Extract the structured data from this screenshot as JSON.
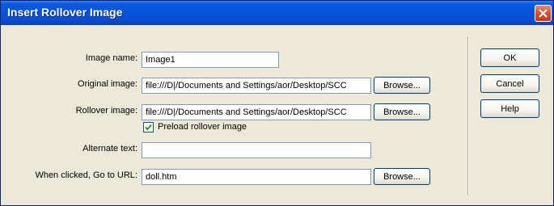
{
  "window": {
    "title": "Insert Rollover Image"
  },
  "form": {
    "image_name_label": "Image name:",
    "image_name_value": "Image1",
    "original_image_label": "Original image:",
    "original_image_value": "file:///D|/Documents and Settings/aor/Desktop/SCC",
    "rollover_image_label": "Rollover image:",
    "rollover_image_value": "file:///D|/Documents and Settings/aor/Desktop/SCC",
    "preload_label": "Preload rollover image",
    "preload_checked": true,
    "alternate_text_label": "Alternate text:",
    "alternate_text_value": "",
    "url_label": "When clicked, Go to URL:",
    "url_value": "doll.htm",
    "browse_label": "Browse..."
  },
  "buttons": {
    "ok": "OK",
    "cancel": "Cancel",
    "help": "Help"
  },
  "colors": {
    "titlebar": "#0553d9",
    "dialog_bg": "#ece9d8",
    "close": "#d7502d",
    "field_border": "#7f9db9",
    "check": "#21a121"
  },
  "icons": {
    "close": "close-x-icon",
    "checkmark": "checkmark-icon"
  }
}
